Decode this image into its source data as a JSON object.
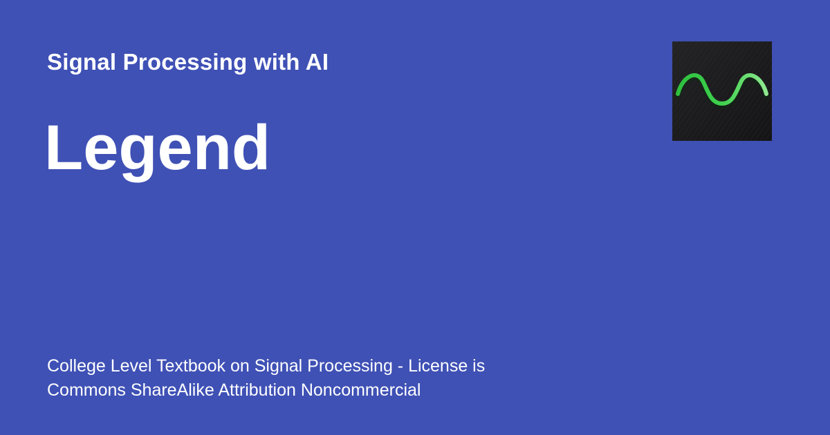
{
  "site": {
    "name": "Signal Processing with AI"
  },
  "page": {
    "title": "Legend",
    "description_lines": [
      "College Level Textbook on Signal Processing - License is",
      "Commons ShareAlike Attribution Noncommercial"
    ]
  },
  "logo": {
    "icon": "sine-wave-icon"
  },
  "colors": {
    "background": "#3f51b5",
    "text": "#ffffff",
    "logo_background": "#1c1c1e",
    "wave": "#4cd964"
  }
}
